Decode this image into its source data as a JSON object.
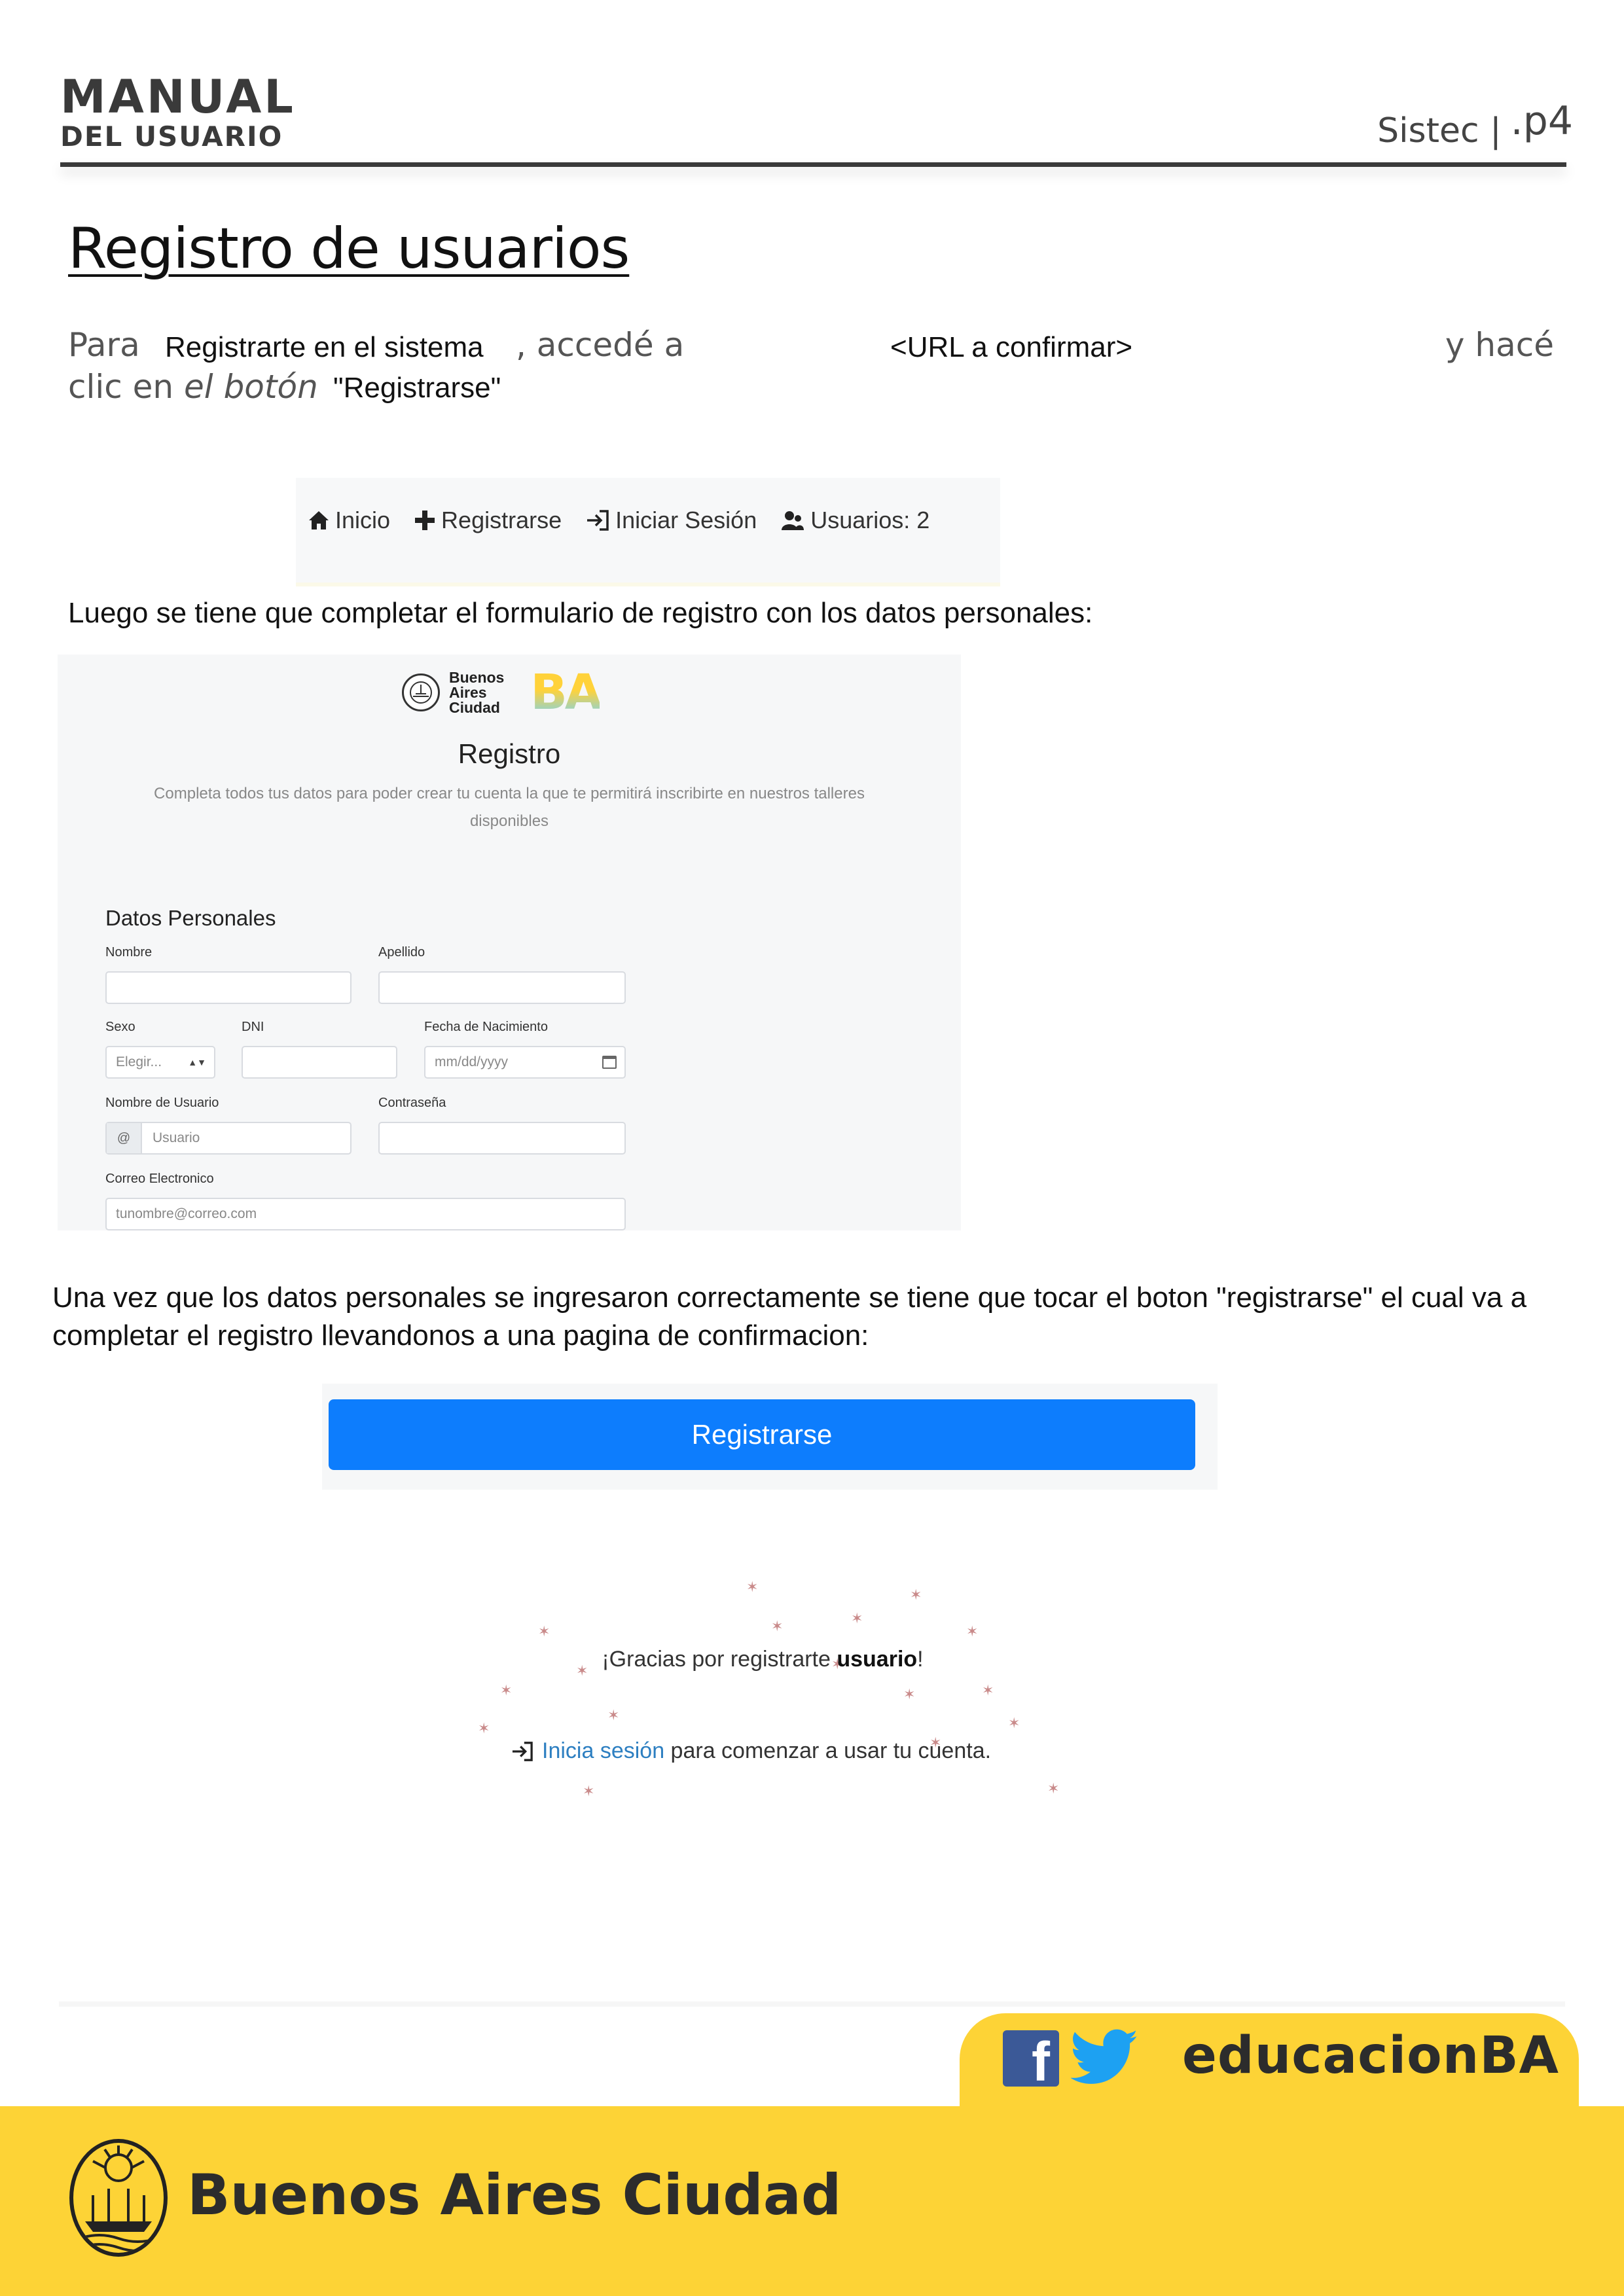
{
  "header": {
    "brand_line1": "MANUAL",
    "brand_line2": "DEL USUARIO",
    "system": "Sistec |",
    "page": ".p4"
  },
  "section": {
    "title": "Registro de usuarios",
    "intro": {
      "para": "Para",
      "registrarte": "Registrarte en el sistema",
      "accede": ", accedé a",
      "url": "<URL a confirmar>",
      "hace": "y hacé",
      "clic": "clic en ",
      "boton": "el botón",
      "registrarse_quoted": "\"Registrarse\""
    },
    "form_instructions": "Luego se tiene que completar el formulario de registro con los datos personales:",
    "confirm_instructions": "Una vez que los datos personales se ingresaron correctamente se tiene que tocar el boton \"registrarse\" el cual va a completar el registro llevandonos a una pagina de confirmacion:"
  },
  "navbar": {
    "items": [
      {
        "label": "Inicio",
        "icon": "home-icon"
      },
      {
        "label": "Registrarse",
        "icon": "plus-icon"
      },
      {
        "label": "Iniciar Sesión",
        "icon": "login-icon"
      },
      {
        "label": "Usuarios: 2",
        "icon": "users-icon"
      }
    ]
  },
  "form": {
    "logo_text": [
      "Buenos",
      "Aires",
      "Ciudad"
    ],
    "ba_logo": "BA",
    "title": "Registro",
    "subtitle": "Completa todos tus datos para poder crear tu cuenta la que te permitirá inscribirte en nuestros talleres disponibles",
    "section": "Datos Personales",
    "labels": {
      "nombre": "Nombre",
      "apellido": "Apellido",
      "sexo": "Sexo",
      "dni": "DNI",
      "fecha": "Fecha de Nacimiento",
      "usuario": "Nombre de Usuario",
      "contrasena": "Contraseña",
      "correo": "Correo Electronico"
    },
    "sexo_value": "Elegir...",
    "fecha_placeholder": "mm/dd/yyyy",
    "usuario_addon": "@",
    "usuario_placeholder": "Usuario",
    "correo_placeholder": "tunombre@correo.com"
  },
  "register_button": "Registrarse",
  "confirmation": {
    "thanks_prefix": "¡Gracias por registrarte ",
    "thanks_user": "usuario",
    "thanks_suffix": "!",
    "link": "Inicia sesión",
    "rest": " para comenzar a usar tu cuenta."
  },
  "footer": {
    "social_handle": "educacionBA",
    "city": "Buenos Aires Ciudad",
    "facebook_letter": "f"
  },
  "colors": {
    "footer_yellow": "#fdd336",
    "button_blue": "#0d7dfd",
    "link_blue": "#2d7fc1",
    "facebook_blue": "#3b5997",
    "twitter_blue": "#1da1f2"
  }
}
